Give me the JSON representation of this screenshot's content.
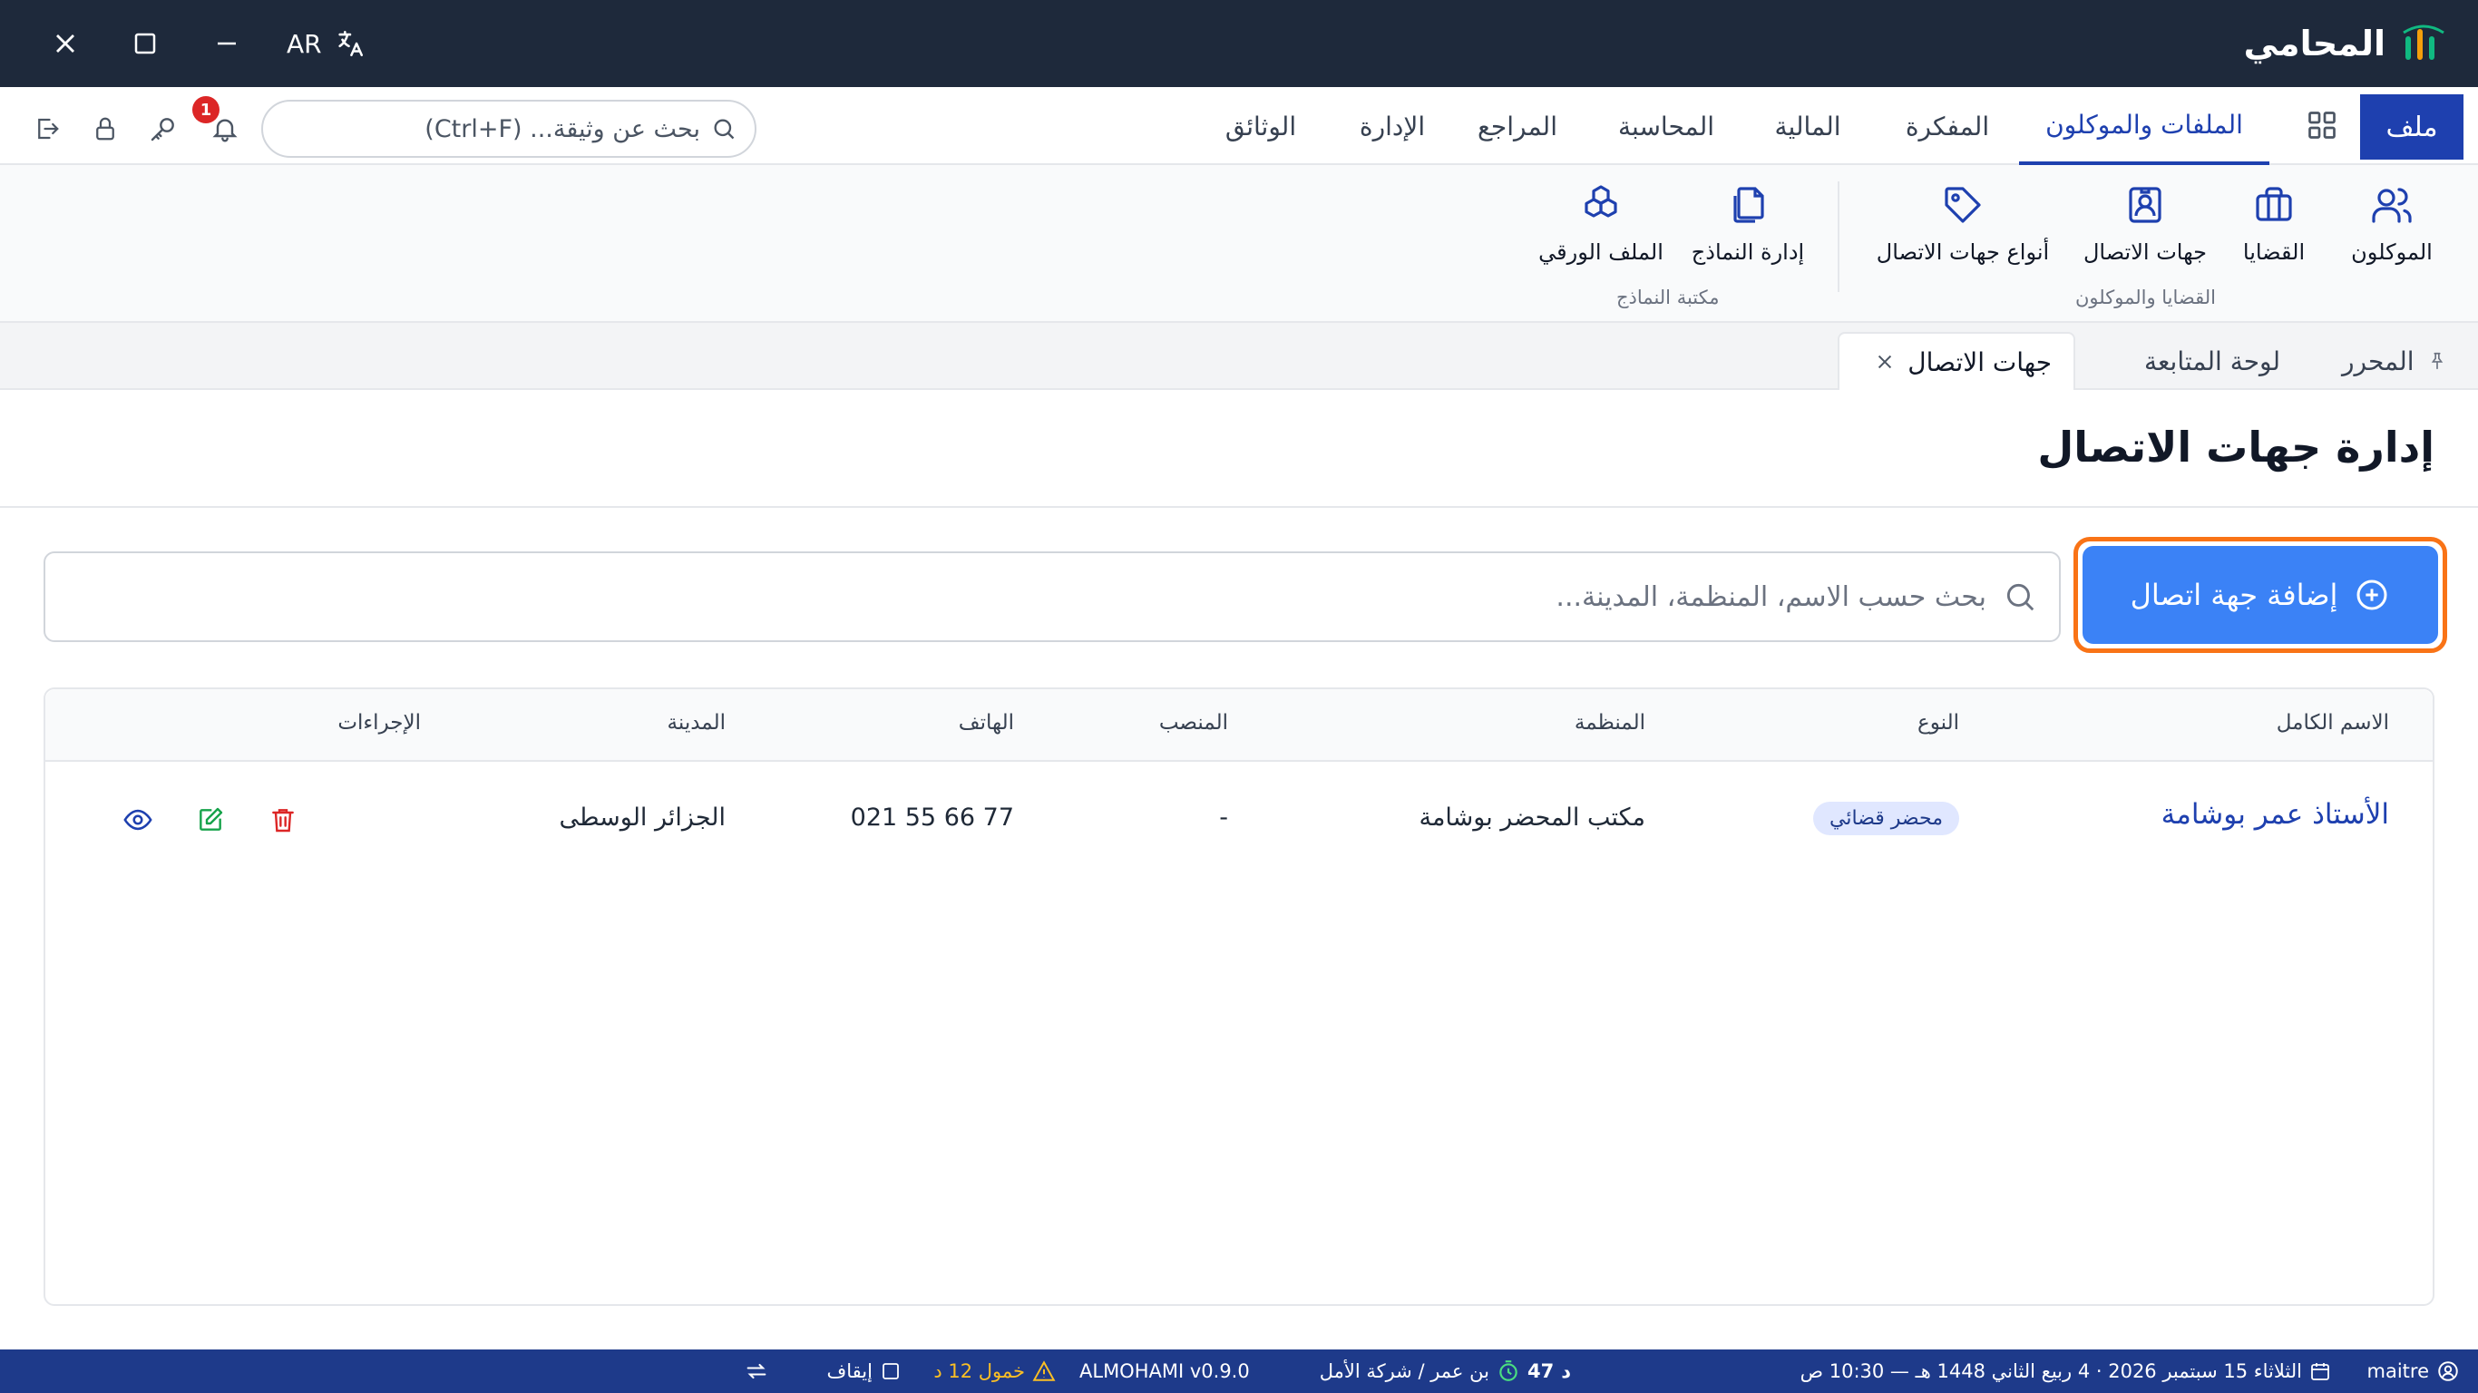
{
  "app": {
    "name": "المحامي"
  },
  "window": {
    "lang_label": "AR"
  },
  "menu": {
    "file": "ملف",
    "tabs": [
      "الملفات والموكلون",
      "المفكرة",
      "المالية",
      "المحاسبة",
      "المراجع",
      "الإدارة",
      "الوثائق"
    ],
    "active_tab": "الملفات والموكلون",
    "search_placeholder": "بحث عن وثيقة... (Ctrl+F)",
    "notification_count": "1"
  },
  "ribbon": {
    "groups": [
      {
        "label": "القضايا والموكلون",
        "items": [
          "الموكلون",
          "القضايا",
          "جهات الاتصال",
          "أنواع جهات الاتصال"
        ]
      },
      {
        "label": "مكتبة النماذج",
        "items": [
          "إدارة النماذج",
          "الملف الورقي"
        ]
      }
    ]
  },
  "doc_tabs": {
    "items": [
      "المحرر",
      "لوحة المتابعة",
      "جهات الاتصال"
    ],
    "active": "جهات الاتصال"
  },
  "page": {
    "title": "إدارة جهات الاتصال",
    "add_button": "إضافة جهة اتصال",
    "search_placeholder": "بحث حسب الاسم، المنظمة، المدينة..."
  },
  "table": {
    "columns": [
      "الاسم الكامل",
      "النوع",
      "المنظمة",
      "المنصب",
      "الهاتف",
      "المدينة",
      "الإجراءات"
    ],
    "rows": [
      {
        "name": "الأستاذ عمر بوشامة",
        "type": "محضر قضائي",
        "organization": "مكتب المحضر بوشامة",
        "position": "-",
        "phone": "021 55 66 77",
        "city": "الجزائر الوسطى"
      }
    ]
  },
  "status_bar": {
    "user": "maitre",
    "date": "الثلاثاء 15 سبتمبر 2026 · 4 ربيع الثاني 1448 هـ — 10:30 ص",
    "timer_value": "47",
    "timer_unit": "د",
    "client": "بن عمر / شركة الأمل",
    "inactivity": "خمول 12 د",
    "pause": "إيقاف",
    "version": "ALMOHAMI v0.9.0"
  },
  "colors": {
    "titlebar": "#1e293b",
    "accent": "#1e40af",
    "primary_button": "#3b82f6",
    "focus_ring": "#f97316",
    "statusbar": "#1e3a8a",
    "danger": "#dc2626",
    "success": "#16a34a"
  }
}
